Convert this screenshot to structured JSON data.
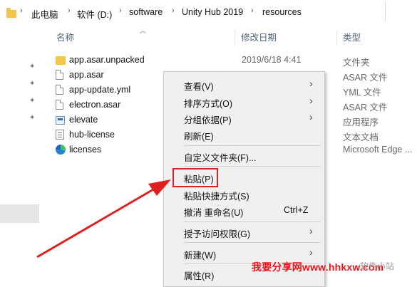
{
  "breadcrumb": {
    "items": [
      "此电脑",
      "软件 (D:)",
      "software",
      "Unity Hub 2019",
      "resources"
    ]
  },
  "columns": {
    "name": "名称",
    "date": "修改日期",
    "type": "类型"
  },
  "files": [
    {
      "name": "app.asar.unpacked",
      "date": "2019/6/18 4:41",
      "type": "文件夹",
      "icon": "folder-icon"
    },
    {
      "name": "app.asar",
      "date": "",
      "type": "ASAR 文件",
      "icon": "file-icon"
    },
    {
      "name": "app-update.yml",
      "date": "",
      "type": "YML 文件",
      "icon": "file-icon"
    },
    {
      "name": "electron.asar",
      "date": "",
      "type": "ASAR 文件",
      "icon": "file-icon"
    },
    {
      "name": "elevate",
      "date": "",
      "type": "应用程序",
      "icon": "application-icon"
    },
    {
      "name": "hub-license",
      "date": "",
      "type": "文本文档",
      "icon": "text-document-icon"
    },
    {
      "name": "licenses",
      "date": "",
      "type": "Microsoft Edge ...",
      "icon": "edge-icon"
    }
  ],
  "context_menu": {
    "items": [
      {
        "label": "查看(V)",
        "submenu": true
      },
      {
        "label": "排序方式(O)",
        "submenu": true
      },
      {
        "label": "分组依据(P)",
        "submenu": true
      },
      {
        "label": "刷新(E)",
        "submenu": false
      },
      {
        "label": "自定义文件夹(F)...",
        "submenu": false
      },
      {
        "label": "粘贴(P)",
        "submenu": false
      },
      {
        "label": "粘贴快捷方式(S)",
        "submenu": false
      },
      {
        "label": "撤消 重命名(U)",
        "shortcut": "Ctrl+Z",
        "submenu": false
      },
      {
        "label": "授予访问权限(G)",
        "submenu": true
      },
      {
        "label": "新建(W)",
        "submenu": true
      },
      {
        "label": "属性(R)",
        "submenu": false
      }
    ]
  },
  "watermark": {
    "text": "我要分享网www.hhkxw.com",
    "secondary": "软件小站"
  },
  "colors": {
    "highlight_box": "#e02020",
    "arrow": "#e02020"
  }
}
